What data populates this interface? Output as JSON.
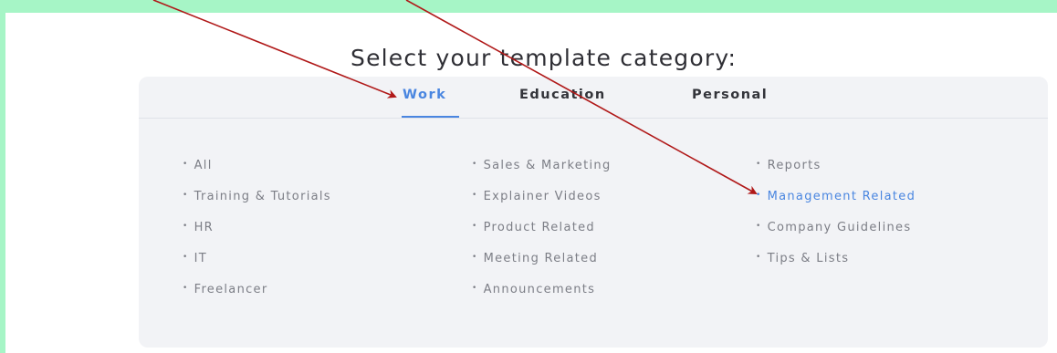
{
  "title": "Select your template category:",
  "tabs": [
    {
      "label": "Work",
      "active": true
    },
    {
      "label": "Education",
      "active": false
    },
    {
      "label": "Personal",
      "active": false
    }
  ],
  "columns": [
    [
      "All",
      "Training & Tutorials",
      "HR",
      "IT",
      "Freelancer"
    ],
    [
      "Sales & Marketing",
      "Explainer Videos",
      "Product Related",
      "Meeting Related",
      "Announcements"
    ],
    [
      "Reports",
      "Management Related",
      "Company Guidelines",
      "Tips & Lists"
    ]
  ],
  "highlighted_item": "Management Related",
  "colors": {
    "frame": "#a6f5c6",
    "panel": "#f2f3f6",
    "accent": "#4a86e0",
    "arrow": "#b01818"
  }
}
